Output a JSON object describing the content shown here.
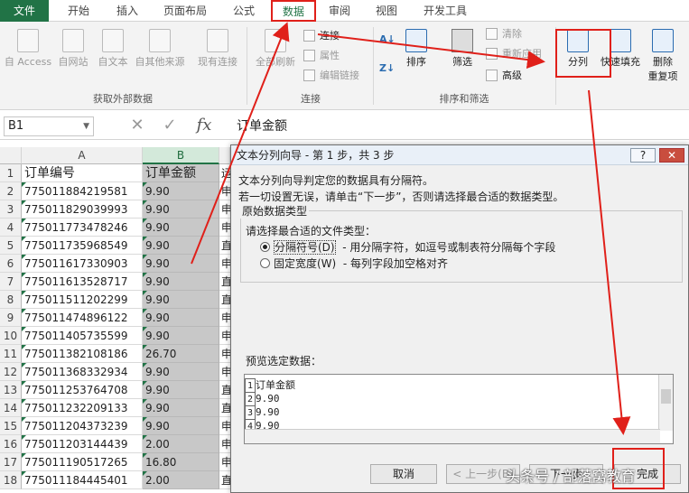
{
  "tabs": [
    "文件",
    "开始",
    "插入",
    "页面布局",
    "公式",
    "数据",
    "审阅",
    "视图",
    "开发工具"
  ],
  "ribbon": {
    "external": {
      "access": "自 Access",
      "web": "自网站",
      "text": "自文本",
      "other": "自其他来源",
      "existing": "现有连接",
      "group": "获取外部数据"
    },
    "connections": {
      "refresh": "全部刷新",
      "conn": "连接",
      "props": "属性",
      "edit_links": "编辑链接",
      "group": "连接"
    },
    "sort": {
      "sort": "排序",
      "filter": "筛选",
      "clear": "清除",
      "reapply": "重新应用",
      "advanced": "高级",
      "group": "排序和筛选"
    },
    "tools": {
      "split": "分列",
      "flash_fill": "快速填充",
      "remove_dup_1": "删除",
      "remove_dup_2": "重复项"
    }
  },
  "formula_bar": {
    "name_box": "B1",
    "fx": "fx",
    "value": "订单金额"
  },
  "grid": {
    "col_a": "A",
    "col_b": "B",
    "header": {
      "row": "1",
      "a": "订单编号",
      "b": "订单金额",
      "c": "运"
    },
    "rows": [
      {
        "n": "2",
        "a": "775011884219581",
        "b": "9.90",
        "c": "申"
      },
      {
        "n": "3",
        "a": "775011829039993",
        "b": "9.90",
        "c": "申"
      },
      {
        "n": "4",
        "a": "775011773478246",
        "b": "9.90",
        "c": "申"
      },
      {
        "n": "5",
        "a": "775011735968549",
        "b": "9.90",
        "c": "直"
      },
      {
        "n": "6",
        "a": "775011617330903",
        "b": "9.90",
        "c": "申"
      },
      {
        "n": "7",
        "a": "775011613528717",
        "b": "9.90",
        "c": "直"
      },
      {
        "n": "8",
        "a": "775011511202299",
        "b": "9.90",
        "c": "直"
      },
      {
        "n": "9",
        "a": "775011474896122",
        "b": "9.90",
        "c": "申"
      },
      {
        "n": "10",
        "a": "775011405735599",
        "b": "9.90",
        "c": "申"
      },
      {
        "n": "11",
        "a": "775011382108186",
        "b": "26.70",
        "c": "申"
      },
      {
        "n": "12",
        "a": "775011368332934",
        "b": "9.90",
        "c": "申"
      },
      {
        "n": "13",
        "a": "775011253764708",
        "b": "9.90",
        "c": "直"
      },
      {
        "n": "14",
        "a": "775011232209133",
        "b": "9.90",
        "c": "直"
      },
      {
        "n": "15",
        "a": "775011204373239",
        "b": "9.90",
        "c": "申"
      },
      {
        "n": "16",
        "a": "775011203144439",
        "b": "2.00",
        "c": "申"
      },
      {
        "n": "17",
        "a": "775011190517265",
        "b": "16.80",
        "c": "申"
      },
      {
        "n": "18",
        "a": "775011184445401",
        "b": "2.00",
        "c": "直"
      }
    ]
  },
  "dialog": {
    "title": "文本分列向导 - 第 1 步，共 3 步",
    "help": "?",
    "close": "✕",
    "line1": "文本分列向导判定您的数据具有分隔符。",
    "line2": "若一切设置无误，请单击“下一步”，否则请选择最合适的数据类型。",
    "group": "原始数据类型",
    "choose": "请选择最合适的文件类型：",
    "opt1": "分隔符号(D)",
    "opt1_desc": "- 用分隔字符，如逗号或制表符分隔每个字段",
    "opt2": "固定宽度(W)",
    "opt2_desc": "- 每列字段加空格对齐",
    "preview_label": "预览选定数据：",
    "preview": [
      {
        "n": "1",
        "v": "订单金额"
      },
      {
        "n": "2",
        "v": "9.90"
      },
      {
        "n": "3",
        "v": "9.90"
      },
      {
        "n": "4",
        "v": "9.90"
      }
    ],
    "cancel": "取消",
    "back": "< 上一步(B)",
    "next": "下一步",
    "finish": "完成"
  },
  "watermark": "头条号 / 部落窝教育",
  "colors": {
    "accent": "#217346",
    "annotation": "#e0201a"
  }
}
